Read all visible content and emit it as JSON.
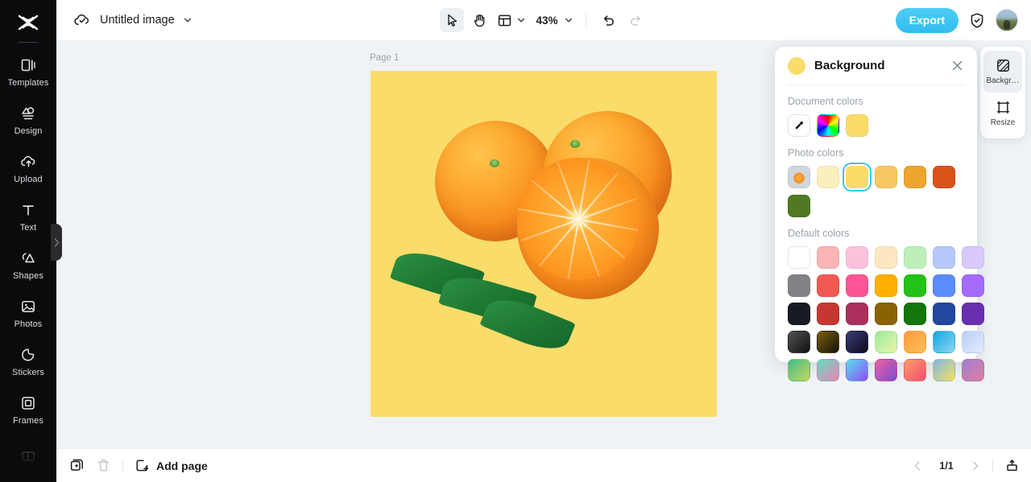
{
  "app": {
    "logo": "capcut-logo-icon"
  },
  "sidebar": {
    "items": [
      {
        "label": "Templates",
        "icon": "templates-icon"
      },
      {
        "label": "Design",
        "icon": "design-icon"
      },
      {
        "label": "Upload",
        "icon": "upload-cloud-icon"
      },
      {
        "label": "Text",
        "icon": "text-icon"
      },
      {
        "label": "Shapes",
        "icon": "shapes-icon"
      },
      {
        "label": "Photos",
        "icon": "photos-icon"
      },
      {
        "label": "Stickers",
        "icon": "stickers-icon"
      },
      {
        "label": "Frames",
        "icon": "frames-icon"
      },
      {
        "label": "",
        "icon": "layout-icon"
      }
    ],
    "collapse_handle": "collapse-sidebar-handle"
  },
  "topbar": {
    "cloud_icon": "cloud-saved-icon",
    "doc_title": "Untitled image",
    "title_chevron": "chevron-down-icon",
    "tools": [
      {
        "name": "select-tool",
        "icon": "cursor-arrow-icon",
        "active": true
      },
      {
        "name": "hand-tool",
        "icon": "hand-icon",
        "active": false
      }
    ],
    "layout_icon": "layout-grid-icon",
    "layout_chevron": "chevron-down-icon",
    "zoom_level": "43%",
    "zoom_chevron": "chevron-down-icon",
    "undo_icon": "undo-icon",
    "redo_icon": "redo-icon",
    "redo_disabled": true,
    "export_label": "Export",
    "shield_icon": "shield-check-icon",
    "avatar": "user-avatar"
  },
  "canvas": {
    "page_label": "Page 1",
    "background_color": "#fadc6b",
    "image_alt": "two-oranges-and-half-slice-with-leaves",
    "workspace_color": "#eff3f6"
  },
  "background_panel": {
    "title": "Background",
    "current_color": "#fadc6b",
    "close_icon": "close-icon",
    "sections": [
      {
        "title": "Document colors",
        "swatches": [
          {
            "type": "eyedropper",
            "name": "eyedropper-tool"
          },
          {
            "type": "rainbow",
            "name": "color-picker-rainbow"
          },
          {
            "type": "color",
            "color": "#fadc6b",
            "selected": false
          }
        ]
      },
      {
        "title": "Photo colors",
        "swatches": [
          {
            "type": "photo",
            "name": "source-photo-thumbnail"
          },
          {
            "type": "color",
            "color": "#fbf0bd",
            "selected": false
          },
          {
            "type": "color",
            "color": "#fadc6b",
            "selected": true
          },
          {
            "type": "color",
            "color": "#f7c862",
            "selected": false
          },
          {
            "type": "color",
            "color": "#eda52e",
            "selected": false
          },
          {
            "type": "color",
            "color": "#d9531a",
            "selected": false
          },
          {
            "type": "color",
            "color": "#4f7a22",
            "selected": false
          }
        ]
      },
      {
        "title": "Default colors",
        "rows": [
          [
            "#ffffff",
            "#fcb4b4",
            "#fbc2dc",
            "#fce8c0",
            "#bdf0b8",
            "#b4c8fb",
            "#d9c8fb"
          ],
          [
            "#808285",
            "#f15a52",
            "#fc5596",
            "#ffaf00",
            "#22c216",
            "#5b8cfb",
            "#a46bfc"
          ],
          [
            "#181a22",
            "#c73731",
            "#ab2f5c",
            "#8a6205",
            "#12760b",
            "#23479f",
            "#6a2fb0"
          ],
          [
            "linear-gradient(135deg,#515154 0%,#111114 100%)",
            "linear-gradient(135deg,#7b6010 0%,#141208 100%)",
            "linear-gradient(135deg,#3b3c78 0%,#0c0b18 100%)",
            "linear-gradient(135deg,#9ce8a2 0%,#e7f7a4 100%)",
            "linear-gradient(135deg,#ff9a3c 0%,#fbbf5a 100%)",
            "linear-gradient(135deg,#12a7e0 0%,#8ed4f2 100%)",
            "linear-gradient(135deg,#b7cffa 0%,#e3ecfd 100%)"
          ],
          [
            "linear-gradient(135deg,#3fbf8e 0%,#c8d45c 100%)",
            "linear-gradient(135deg,#5fe0c0 0%,#f07fb8 100%)",
            "linear-gradient(135deg,#5bdff0 0%,#8f4cf5 100%)",
            "linear-gradient(135deg,#f05fa0 0%,#7a4fd0 100%)",
            "linear-gradient(135deg,#ff9a6a 0%,#f0506f 100%)",
            "linear-gradient(135deg,#7fb6e8 0%,#f5e05c 100%)",
            "linear-gradient(135deg,#a07fd0 0%,#e07fa0 100%)"
          ]
        ]
      }
    ]
  },
  "right_rail": {
    "items": [
      {
        "label": "Backgr…",
        "icon": "background-icon",
        "active": true
      },
      {
        "label": "Resize",
        "icon": "resize-icon",
        "active": false
      }
    ]
  },
  "bottombar": {
    "duplicate_icon": "duplicate-page-icon",
    "delete_icon": "trash-icon",
    "delete_disabled": true,
    "add_page_icon": "add-page-icon",
    "add_page_label": "Add page",
    "prev_icon": "chevron-left-icon",
    "page_indicator": "1/1",
    "next_icon": "chevron-right-icon",
    "export_tray_icon": "export-tray-icon"
  }
}
